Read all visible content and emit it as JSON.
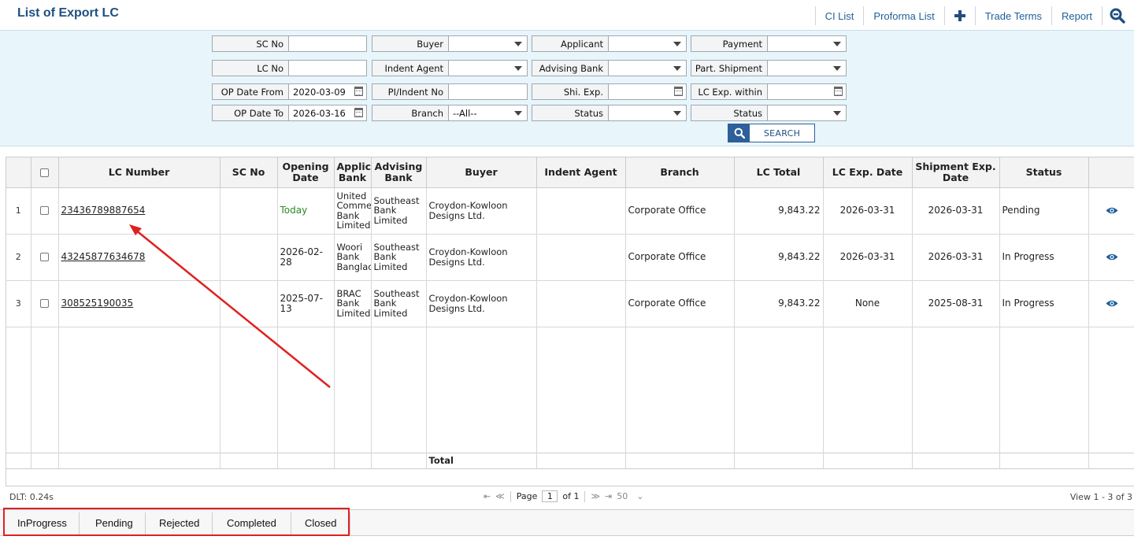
{
  "header": {
    "title": "List of Export LC",
    "toolbar": {
      "ci_list": "CI List",
      "proforma_list": "Proforma List",
      "trade_terms": "Trade Terms",
      "report": "Report"
    }
  },
  "filters": {
    "sc_no": {
      "label": "SC No",
      "value": ""
    },
    "lc_no": {
      "label": "LC No",
      "value": ""
    },
    "op_date_from": {
      "label": "OP Date From",
      "value": "2020-03-09"
    },
    "op_date_to": {
      "label": "OP Date To",
      "value": "2026-03-16"
    },
    "buyer": {
      "label": "Buyer",
      "value": ""
    },
    "indent_agent": {
      "label": "Indent Agent",
      "value": ""
    },
    "pi_indent_no": {
      "label": "PI/Indent No",
      "value": ""
    },
    "branch": {
      "label": "Branch",
      "value": "--All--"
    },
    "applicant": {
      "label": "Applicant",
      "value": ""
    },
    "advising_bank": {
      "label": "Advising Bank",
      "value": ""
    },
    "shi_exp": {
      "label": "Shi. Exp.",
      "value": ""
    },
    "status_1": {
      "label": "Status",
      "value": ""
    },
    "payment": {
      "label": "Payment",
      "value": ""
    },
    "part_shipment": {
      "label": "Part. Shipment",
      "value": ""
    },
    "lc_exp_within": {
      "label": "LC Exp. within",
      "value": ""
    },
    "status_2": {
      "label": "Status",
      "value": ""
    },
    "search_label": "SEARCH"
  },
  "grid": {
    "columns": {
      "lc_number": "LC Number",
      "sc_no": "SC No",
      "opening_date": "Opening Date",
      "applicant_bank": "Applic Bank",
      "advising_bank": "Advising Bank",
      "buyer": "Buyer",
      "indent_agent": "Indent Agent",
      "branch": "Branch",
      "lc_total": "LC Total",
      "lc_exp_date": "LC Exp. Date",
      "shipment_exp_date": "Shipment Exp. Date",
      "status": "Status"
    },
    "rows": [
      {
        "n": "1",
        "lc_number": "23436789887654",
        "sc_no": "",
        "opening_date": "Today",
        "applicant_bank": "United Comme Bank Limited",
        "advising_bank": "Southeast Bank Limited",
        "buyer": "Croydon-Kowloon Designs Ltd.",
        "indent_agent": "",
        "branch": "Corporate Office",
        "lc_total": "9,843.22",
        "lc_exp_date": "2026-03-31",
        "shipment_exp_date": "2026-03-31",
        "status": "Pending"
      },
      {
        "n": "2",
        "lc_number": "43245877634678",
        "sc_no": "",
        "opening_date": "2026-02-28",
        "applicant_bank": "Woori Bank Banglac",
        "advising_bank": "Southeast Bank Limited",
        "buyer": "Croydon-Kowloon Designs Ltd.",
        "indent_agent": "",
        "branch": "Corporate Office",
        "lc_total": "9,843.22",
        "lc_exp_date": "2026-03-31",
        "shipment_exp_date": "2026-03-31",
        "status": "In Progress"
      },
      {
        "n": "3",
        "lc_number": "308525190035",
        "sc_no": "",
        "opening_date": "2025-07-13",
        "applicant_bank": "BRAC Bank Limited",
        "advising_bank": "Southeast Bank Limited",
        "buyer": "Croydon-Kowloon Designs Ltd.",
        "indent_agent": "",
        "branch": "Corporate Office",
        "lc_total": "9,843.22",
        "lc_exp_date": "None",
        "shipment_exp_date": "2025-08-31",
        "status": "In Progress"
      }
    ],
    "total_label": "Total"
  },
  "pager": {
    "dlt": "DLT: 0.24s",
    "page_label": "Page",
    "page_value": "1",
    "of_label": "of 1",
    "page_size": "50",
    "view": "View 1 - 3 of 3"
  },
  "status_tabs": [
    "InProgress",
    "Pending",
    "Rejected",
    "Completed",
    "Closed"
  ],
  "colors": {
    "accent": "#1f4f7f",
    "filter_bg": "#e8f6fb",
    "today": "#2a8a2a",
    "annotation": "#e02020",
    "eye_icon": "#1f5f9a"
  }
}
